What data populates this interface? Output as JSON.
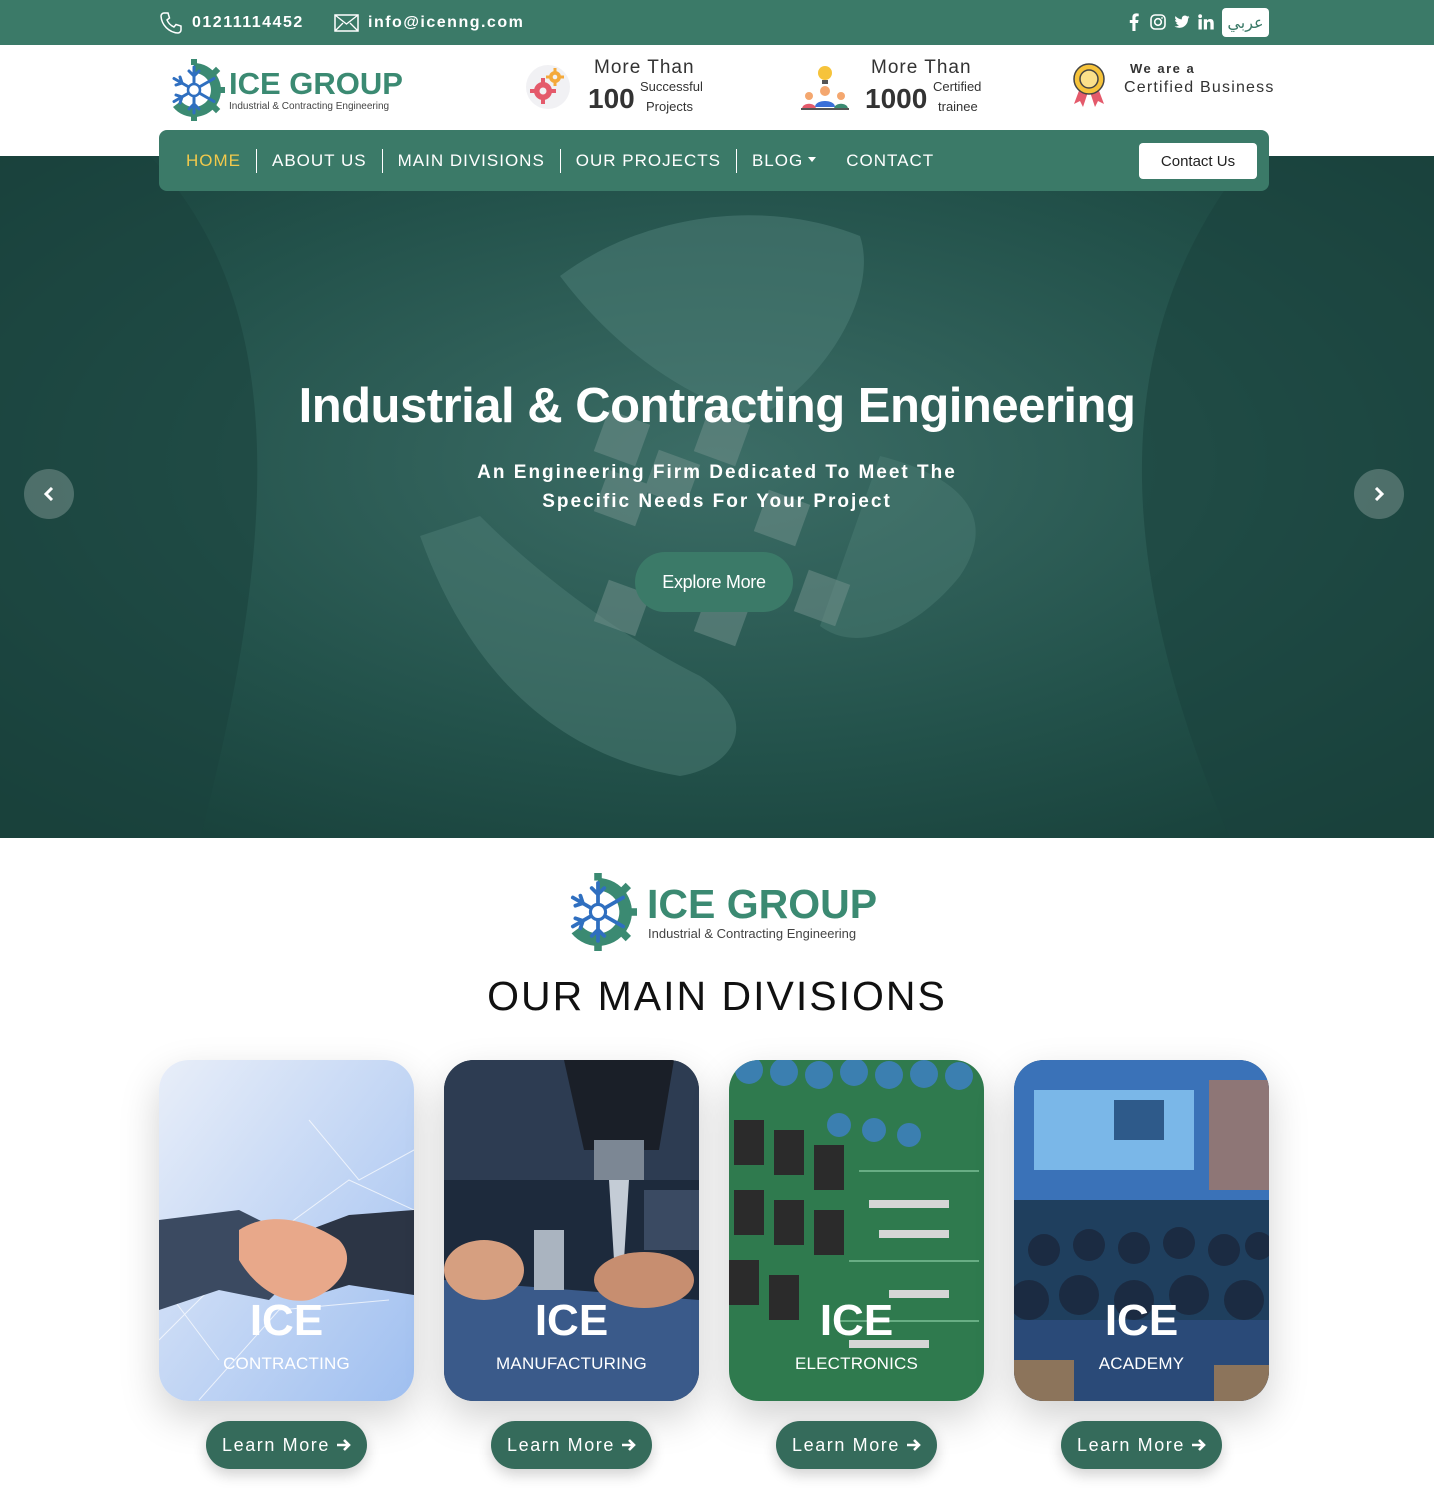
{
  "topbar": {
    "phone": "01211114452",
    "email": "info@icenng.com",
    "socials": [
      "facebook-icon",
      "instagram-icon",
      "twitter-icon",
      "linkedin-icon"
    ],
    "language": "عربي"
  },
  "brand": {
    "name": "ICE GROUP",
    "tagline": "Industrial & Contracting Engineering",
    "color": "#3b8a72"
  },
  "stats": [
    {
      "lead": "More Than",
      "number": "100",
      "line1": "Successful",
      "line2": "Projects",
      "icon": "gears-icon"
    },
    {
      "lead": "More Than",
      "number": "1000",
      "line1": "Certified",
      "line2": "trainee",
      "icon": "trainee-icon"
    }
  ],
  "certified": {
    "line1": "We are a",
    "line2": "Certified Business",
    "icon": "award-badge-icon"
  },
  "nav": {
    "items": [
      "HOME",
      "ABOUT US",
      "MAIN DIVISIONS",
      "OUR PROJECTS",
      "BLOG",
      "CONTACT"
    ],
    "active": "HOME",
    "contact_button": "Contact Us"
  },
  "hero": {
    "title": "Industrial & Contracting Engineering",
    "subtitle_line1": "An Engineering Firm Dedicated To Meet The",
    "subtitle_line2": "Specific Needs For Your Project",
    "button": "Explore More"
  },
  "divisions": {
    "title": "OUR MAIN DIVISIONS",
    "cards": [
      {
        "prefix": "ICE",
        "name": "CONTRACTING",
        "button": "Learn More"
      },
      {
        "prefix": "ICE",
        "name": "MANUFACTURING",
        "button": "Learn More"
      },
      {
        "prefix": "ICE",
        "name": "ELECTRONICS",
        "button": "Learn More"
      },
      {
        "prefix": "ICE",
        "name": "ACADEMY",
        "button": "Learn More"
      }
    ]
  },
  "colors": {
    "primary": "#3b7a68",
    "accent_active": "#f2c94c",
    "hero_overlay": "#1e4f48"
  }
}
